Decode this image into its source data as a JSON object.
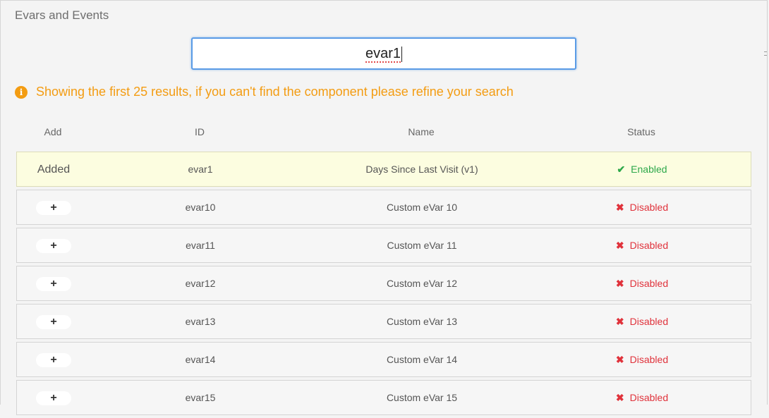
{
  "header": {
    "title": "Evars and Events"
  },
  "search": {
    "value": "evar1"
  },
  "notice": {
    "icon": "info-icon",
    "text": "Showing the first 25 results, if you can't find the component please refine your search",
    "color": "#f39c12"
  },
  "table": {
    "columns": [
      "Add",
      "ID",
      "Name",
      "Status"
    ],
    "rows": [
      {
        "add": "Added",
        "id": "evar1",
        "name": "Days Since Last Visit (v1)",
        "status": "Enabled"
      },
      {
        "add": "+",
        "id": "evar10",
        "name": "Custom eVar 10",
        "status": "Disabled"
      },
      {
        "add": "+",
        "id": "evar11",
        "name": "Custom eVar 11",
        "status": "Disabled"
      },
      {
        "add": "+",
        "id": "evar12",
        "name": "Custom eVar 12",
        "status": "Disabled"
      },
      {
        "add": "+",
        "id": "evar13",
        "name": "Custom eVar 13",
        "status": "Disabled"
      },
      {
        "add": "+",
        "id": "evar14",
        "name": "Custom eVar 14",
        "status": "Disabled"
      },
      {
        "add": "+",
        "id": "evar15",
        "name": "Custom eVar 15",
        "status": "Disabled"
      }
    ]
  },
  "status_colors": {
    "enabled": "#2da84a",
    "disabled": "#e0323b",
    "added_row_bg": "#fcfde0"
  }
}
